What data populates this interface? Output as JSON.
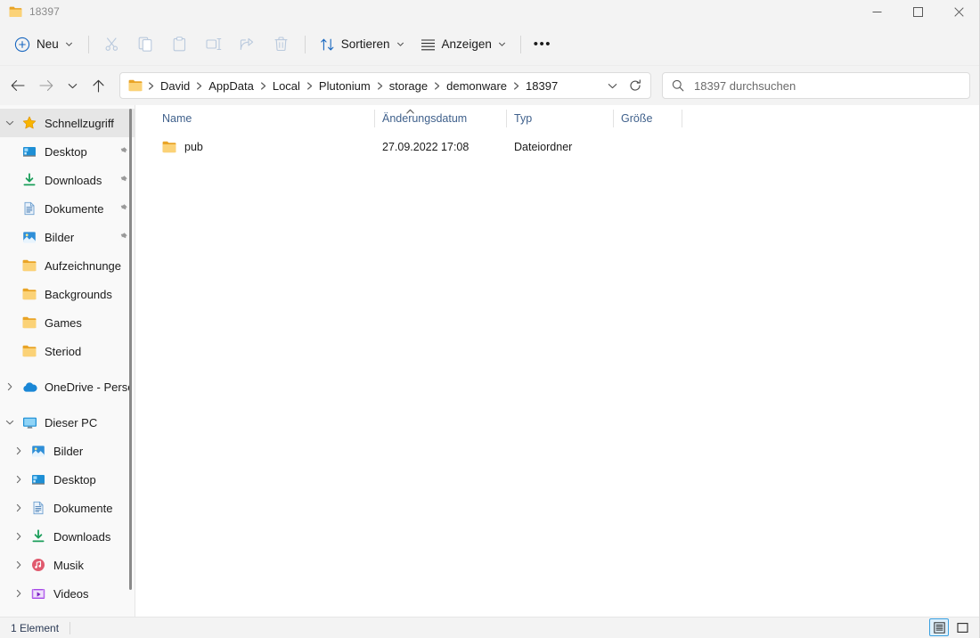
{
  "window": {
    "title": "18397",
    "title_icon": "folder-icon",
    "controls": {
      "minimize": "minimize-icon",
      "maximize": "maximize-icon",
      "close": "close-icon"
    }
  },
  "toolbar": {
    "new_label": "Neu",
    "new_icon": "plus-circle-icon",
    "cut_icon": "scissors-icon",
    "copy_icon": "copy-icon",
    "paste_icon": "paste-icon",
    "rename_icon": "rename-icon",
    "share_icon": "share-icon",
    "delete_icon": "trash-icon",
    "sort_label": "Sortieren",
    "sort_icon": "sort-arrows-icon",
    "view_label": "Anzeigen",
    "view_icon": "lines-icon",
    "more_label": "•••"
  },
  "navbar": {
    "back_icon": "arrow-left-icon",
    "forward_icon": "arrow-right-icon",
    "recent_icon": "chevron-down-icon",
    "up_icon": "arrow-up-icon",
    "breadcrumbs": [
      "David",
      "AppData",
      "Local",
      "Plutonium",
      "storage",
      "demonware",
      "18397"
    ],
    "dropdown_icon": "chevron-down-icon",
    "refresh_icon": "refresh-icon"
  },
  "search": {
    "icon": "search-icon",
    "placeholder": "18397 durchsuchen",
    "value": ""
  },
  "sidebar": {
    "groups": [
      {
        "header": {
          "label": "Schnellzugriff",
          "icon": "star-icon",
          "expanded": true,
          "selected": true
        },
        "items": [
          {
            "label": "Desktop",
            "icon": "desktop-icon",
            "pinned": true
          },
          {
            "label": "Downloads",
            "icon": "download-icon",
            "pinned": true
          },
          {
            "label": "Dokumente",
            "icon": "document-icon",
            "pinned": true
          },
          {
            "label": "Bilder",
            "icon": "pictures-icon",
            "pinned": true
          },
          {
            "label": "Aufzeichnunge",
            "icon": "folder-icon",
            "pinned": false
          },
          {
            "label": "Backgrounds",
            "icon": "folder-icon",
            "pinned": false
          },
          {
            "label": "Games",
            "icon": "folder-icon",
            "pinned": false
          },
          {
            "label": "Steriod",
            "icon": "folder-icon",
            "pinned": false
          }
        ]
      },
      {
        "header": {
          "label": "OneDrive - Perso",
          "icon": "cloud-icon",
          "expanded": false,
          "selected": false
        },
        "items": []
      },
      {
        "header": {
          "label": "Dieser PC",
          "icon": "pc-icon",
          "expanded": true,
          "selected": false
        },
        "items": [
          {
            "label": "Bilder",
            "icon": "pictures-icon",
            "expandable": true
          },
          {
            "label": "Desktop",
            "icon": "desktop-icon",
            "expandable": true
          },
          {
            "label": "Dokumente",
            "icon": "document-icon",
            "expandable": true
          },
          {
            "label": "Downloads",
            "icon": "download-icon",
            "expandable": true
          },
          {
            "label": "Musik",
            "icon": "music-icon",
            "expandable": true
          },
          {
            "label": "Videos",
            "icon": "video-icon",
            "expandable": true
          }
        ]
      }
    ]
  },
  "filelist": {
    "columns": [
      {
        "label": "Name",
        "key": "name"
      },
      {
        "label": "Änderungsdatum",
        "key": "date"
      },
      {
        "label": "Typ",
        "key": "type"
      },
      {
        "label": "Größe",
        "key": "size"
      }
    ],
    "sorted_by": "Name",
    "sort_direction": "ascending",
    "rows": [
      {
        "icon": "folder-icon",
        "name": "pub",
        "date": "27.09.2022 17:08",
        "type": "Dateiordner",
        "size": ""
      }
    ]
  },
  "statusbar": {
    "item_count": "1 Element",
    "views": [
      {
        "name": "details-view",
        "icon": "details-icon",
        "active": true
      },
      {
        "name": "large-icons-view",
        "icon": "large-icons-icon",
        "active": false
      }
    ]
  },
  "colors": {
    "accent": "#0078d4",
    "folder": "#f7c55b",
    "column_header": "#40618c",
    "chrome": "#f3f3f3"
  }
}
